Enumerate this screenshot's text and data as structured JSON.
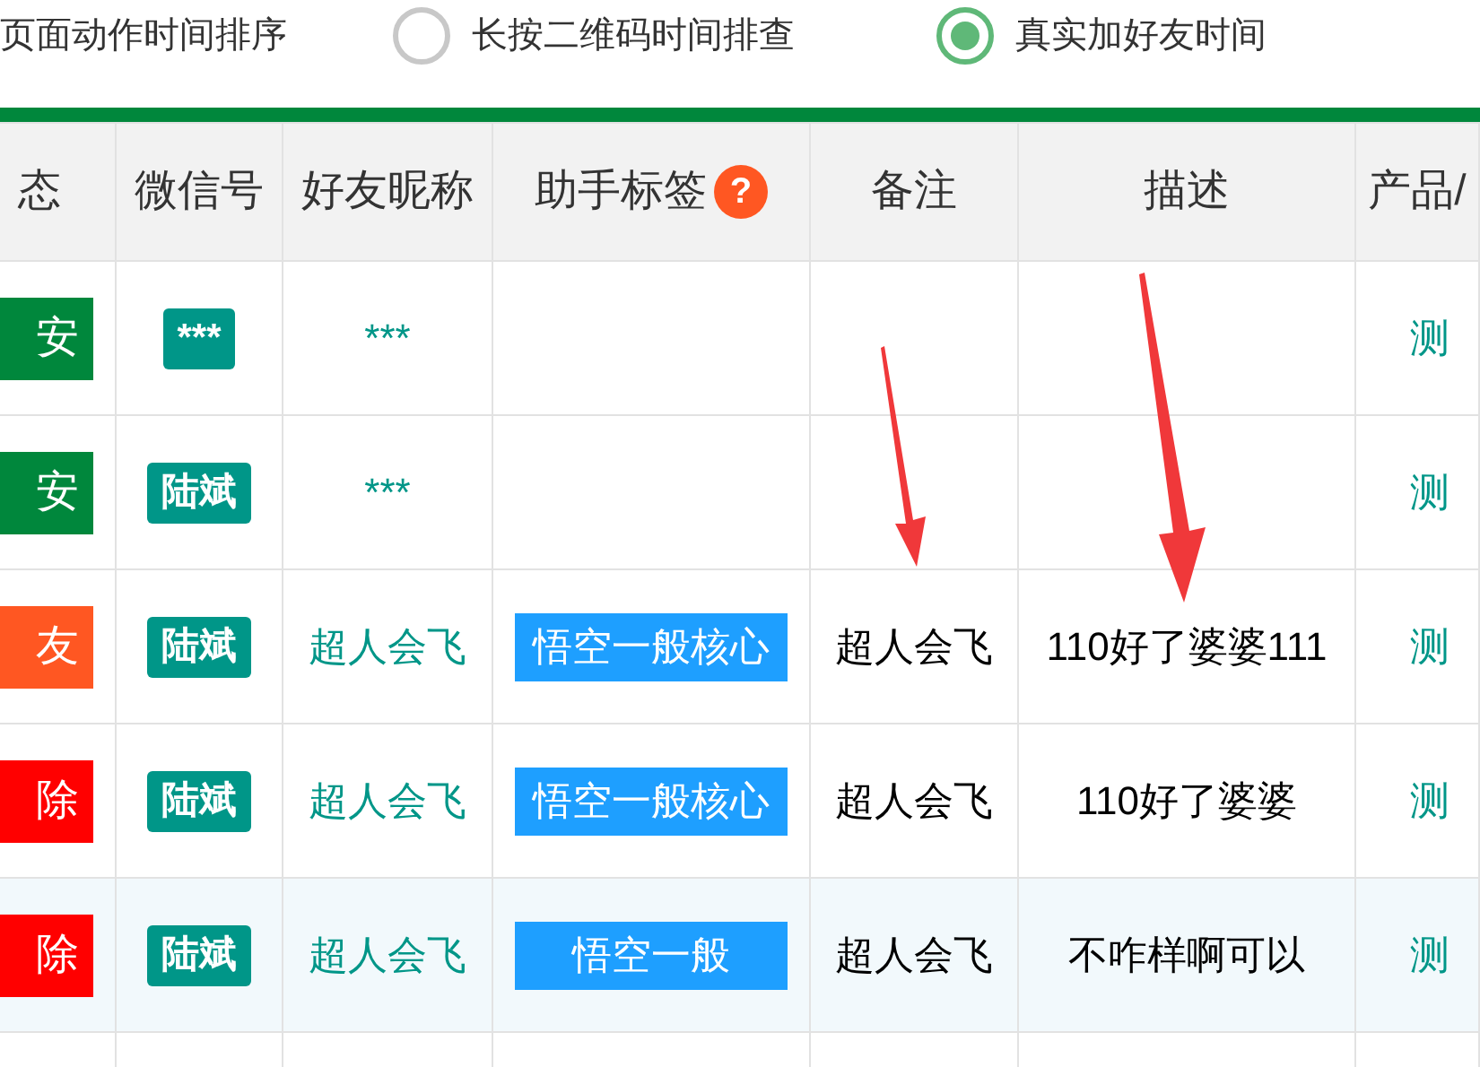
{
  "sort_options": [
    {
      "label": "页面动作时间排序"
    },
    {
      "label": "长按二维码时间排查",
      "selected": false
    },
    {
      "label": "真实加好友时间",
      "selected": true
    }
  ],
  "table": {
    "columns": [
      {
        "label": "态"
      },
      {
        "label": "微信号"
      },
      {
        "label": "好友昵称"
      },
      {
        "label": "助手标签",
        "help": "?"
      },
      {
        "label": "备注"
      },
      {
        "label": "描述"
      },
      {
        "label": "产品/"
      }
    ],
    "rows": [
      {
        "status": {
          "text": "安",
          "color": "#00873c"
        },
        "wechat": "***",
        "nickname": "***",
        "product": "测",
        "highlighted": false
      },
      {
        "status": {
          "text": "安",
          "color": "#00873c"
        },
        "wechat": "陆斌",
        "nickname": "***",
        "product": "测",
        "highlighted": false
      },
      {
        "status": {
          "text": "友",
          "color": "#ff5722"
        },
        "wechat": "陆斌",
        "nickname": "超人会飞",
        "tag": "悟空一般核心",
        "remark": "超人会飞",
        "description": "110好了婆婆111",
        "product": "测",
        "highlighted": false
      },
      {
        "status": {
          "text": "除",
          "color": "#ff0000"
        },
        "wechat": "陆斌",
        "nickname": "超人会飞",
        "tag": "悟空一般核心",
        "remark": "超人会飞",
        "description": "110好了婆婆",
        "product": "测",
        "highlighted": false
      },
      {
        "status": {
          "text": "除",
          "color": "#ff0000"
        },
        "wechat": "陆斌",
        "nickname": "超人会飞",
        "tag": "悟空一般",
        "remark": "超人会飞",
        "description": "不咋样啊可以",
        "product": "测",
        "highlighted": true
      }
    ]
  }
}
